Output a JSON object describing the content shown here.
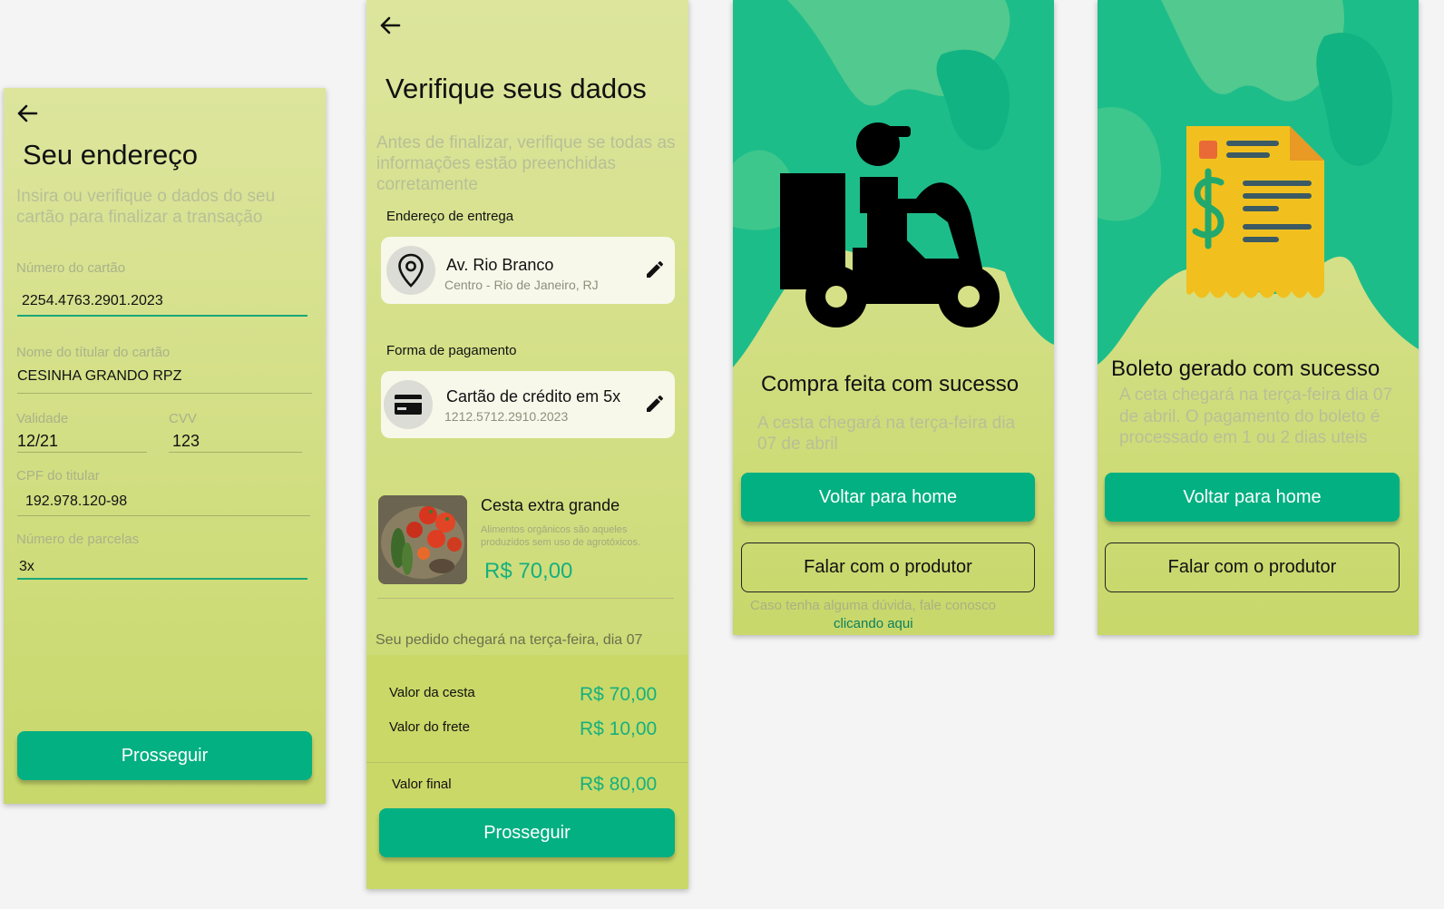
{
  "screen_address": {
    "title": "Seu endereço",
    "subtitle": "Insira ou verifique o dados do seu cartão para finalizar a transação",
    "card_number": {
      "label": "Número do cartão",
      "value": "2254.4763.2901.2023"
    },
    "holder_name": {
      "label": "Nome do títular do cartão",
      "value": "CESINHA GRANDO RPZ"
    },
    "validity": {
      "label": "Validade",
      "value": "12/21"
    },
    "cvv": {
      "label": "CVV",
      "value": "123"
    },
    "cpf": {
      "label": "CPF do titular",
      "value": "192.978.120-98"
    },
    "installments": {
      "label": "Número de parcelas",
      "value": "3x"
    },
    "continue_label": "Prosseguir"
  },
  "screen_verify": {
    "title": "Verifique seus dados",
    "subtitle": "Antes de finalizar, verifique se todas as informações estão preenchidas corretamente",
    "delivery_section": "Endereço de entrega",
    "address": {
      "street": "Av. Rio Branco",
      "detail": "Centro - Rio de Janeiro, RJ"
    },
    "payment_section": "Forma de pagamento",
    "payment": {
      "method": "Cartão de crédito em 5x",
      "number": "1212.5712.2910.2023"
    },
    "product": {
      "name": "Cesta extra grande",
      "description": "Alimentos orgânicos são aqueles produzidos sem uso de agrotóxicos.",
      "price": "R$ 70,00"
    },
    "delivery_note": "Seu pedido chegará na terça-feira, dia 07",
    "summary": [
      {
        "label": "Valor da cesta",
        "value": "R$ 70,00"
      },
      {
        "label": "Valor do frete",
        "value": "R$ 10,00"
      }
    ],
    "total": {
      "label": "Valor final",
      "value": "R$ 80,00"
    },
    "continue_label": "Prosseguir"
  },
  "screen_success": {
    "title": "Compra feita com sucesso",
    "message": "A cesta chegará na terça-feira dia 07 de abril",
    "home_label": "Voltar para home",
    "producer_label": "Falar com o produtor",
    "help_text": "Caso tenha alguma dúvida, fale conosco",
    "help_link": "clicando aqui"
  },
  "screen_boleto": {
    "title": "Boleto gerado com sucesso",
    "message": "A ceta chegará na terça-feira dia 07 de abril. O pagamento do boleto é processado em 1 ou 2 dias uteis",
    "home_label": "Voltar para home",
    "producer_label": "Falar com o produtor"
  },
  "colors": {
    "accent": "#02b082",
    "background_top": "#dde59d",
    "background_bottom": "#c8d86a",
    "blob": "#1dbd8a",
    "price": "#16b07e"
  },
  "icons": [
    "back-arrow-icon",
    "location-pin-icon",
    "edit-pencil-icon",
    "credit-card-icon",
    "delivery-scooter-icon",
    "boleto-receipt-icon"
  ]
}
